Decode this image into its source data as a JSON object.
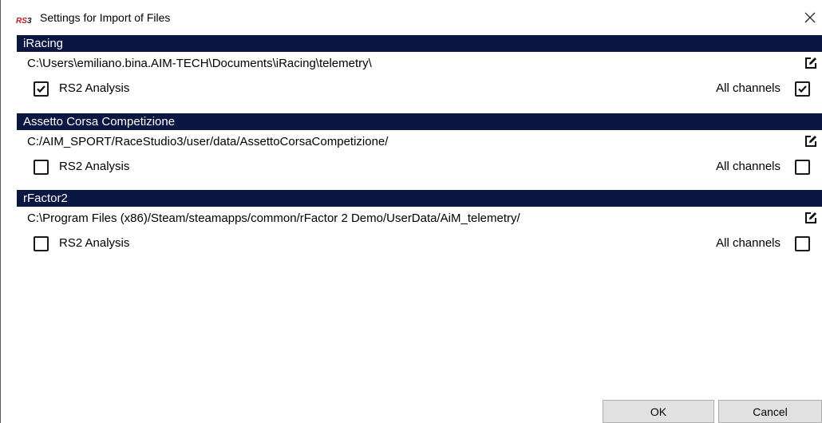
{
  "window": {
    "title": "Settings for Import of Files",
    "app_icon": "rs3-icon",
    "close_icon": "close-icon"
  },
  "sections": [
    {
      "name": "iRacing",
      "path": "C:\\Users\\emiliano.bina.AIM-TECH\\Documents\\iRacing\\telemetry\\",
      "option_label": "RS2 Analysis",
      "option_checked": true,
      "all_channels_label": "All channels",
      "all_channels_checked": true
    },
    {
      "name": "Assetto Corsa Competizione",
      "path": "C:/AIM_SPORT/RaceStudio3/user/data/AssettoCorsaCompetizione/",
      "option_label": "RS2 Analysis",
      "option_checked": false,
      "all_channels_label": "All channels",
      "all_channels_checked": false
    },
    {
      "name": "rFactor2",
      "path": "C:\\Program Files (x86)/Steam/steamapps/common/rFactor 2 Demo/UserData/AiM_telemetry/",
      "option_label": "RS2 Analysis",
      "option_checked": false,
      "all_channels_label": "All channels",
      "all_channels_checked": false
    }
  ],
  "buttons": {
    "ok_label": "OK",
    "cancel_label": "Cancel"
  },
  "colors": {
    "section_header_bg": "#0b1743",
    "section_header_text": "#ffffff",
    "button_bg": "#e1e1e1"
  }
}
